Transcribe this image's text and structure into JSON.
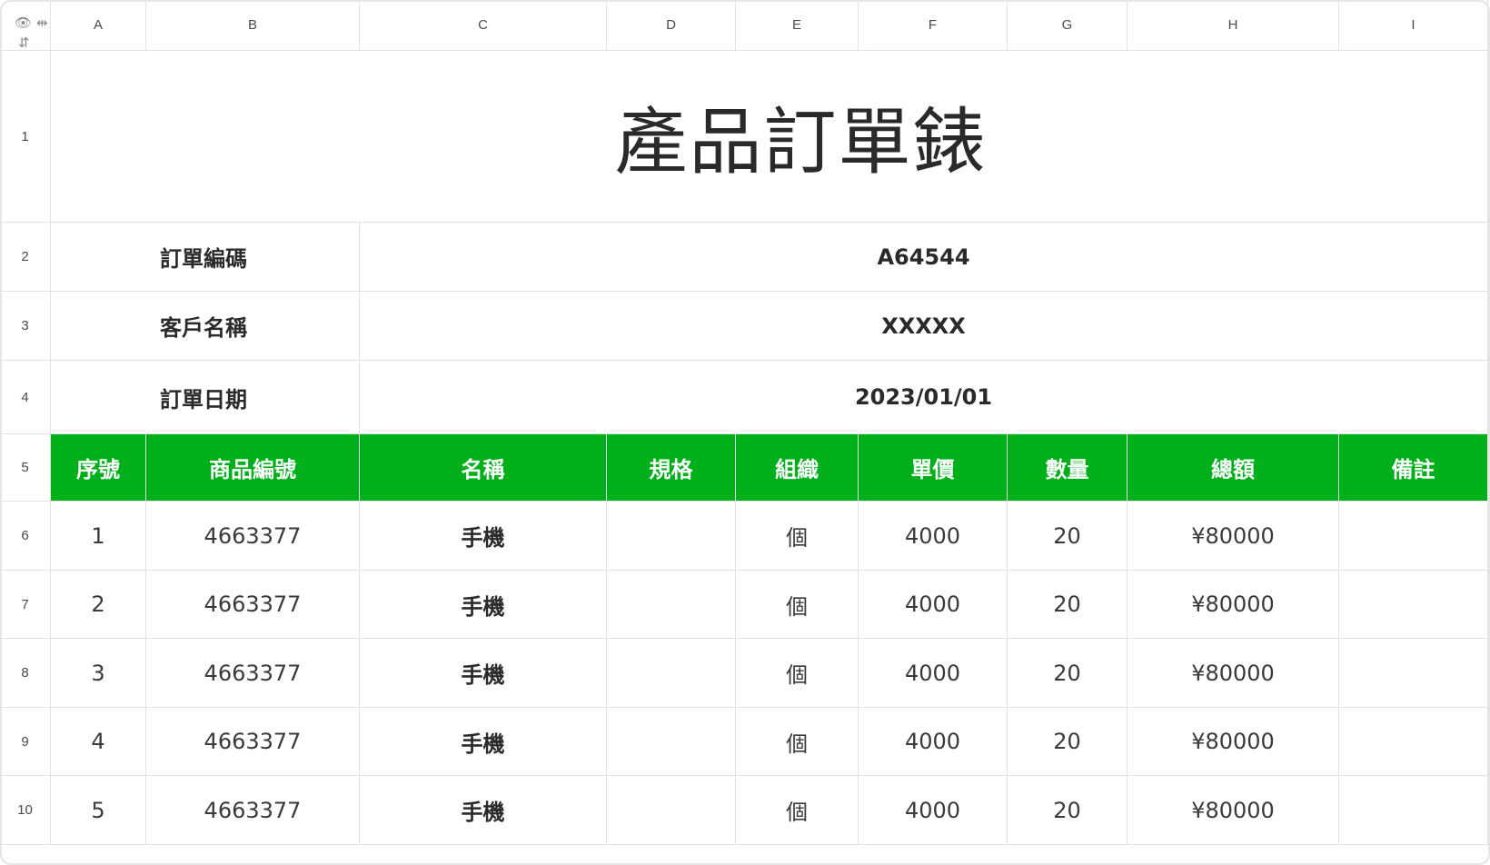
{
  "corner": {
    "icons": [
      "eye-icon",
      "collapse-columns-icon",
      "collapse-rows-icon"
    ]
  },
  "column_headers": [
    "A",
    "B",
    "C",
    "D",
    "E",
    "F",
    "G",
    "H",
    "I"
  ],
  "row_numbers": [
    "1",
    "2",
    "3",
    "4",
    "5",
    "6",
    "7",
    "8",
    "9",
    "10"
  ],
  "sheet": {
    "title": "產品訂單錶",
    "info": [
      {
        "label": "訂單編碼",
        "value": "A64544"
      },
      {
        "label": "客戶名稱",
        "value": "XXXXX"
      },
      {
        "label": "訂單日期",
        "value": "2023/01/01"
      }
    ],
    "table_headers": [
      "序號",
      "商品編號",
      "名稱",
      "規格",
      "組織",
      "單價",
      "數量",
      "總額",
      "備註"
    ],
    "rows": [
      [
        "1",
        "4663377",
        "手機",
        "",
        "個",
        "4000",
        "20",
        "¥80000",
        ""
      ],
      [
        "2",
        "4663377",
        "手機",
        "",
        "個",
        "4000",
        "20",
        "¥80000",
        ""
      ],
      [
        "3",
        "4663377",
        "手機",
        "",
        "個",
        "4000",
        "20",
        "¥80000",
        ""
      ],
      [
        "4",
        "4663377",
        "手機",
        "",
        "個",
        "4000",
        "20",
        "¥80000",
        ""
      ],
      [
        "5",
        "4663377",
        "手機",
        "",
        "個",
        "4000",
        "20",
        "¥80000",
        ""
      ]
    ]
  },
  "colors": {
    "header_green": "#00b01a",
    "grid_line": "#e3e3e3",
    "text": "#2b2b2b"
  }
}
